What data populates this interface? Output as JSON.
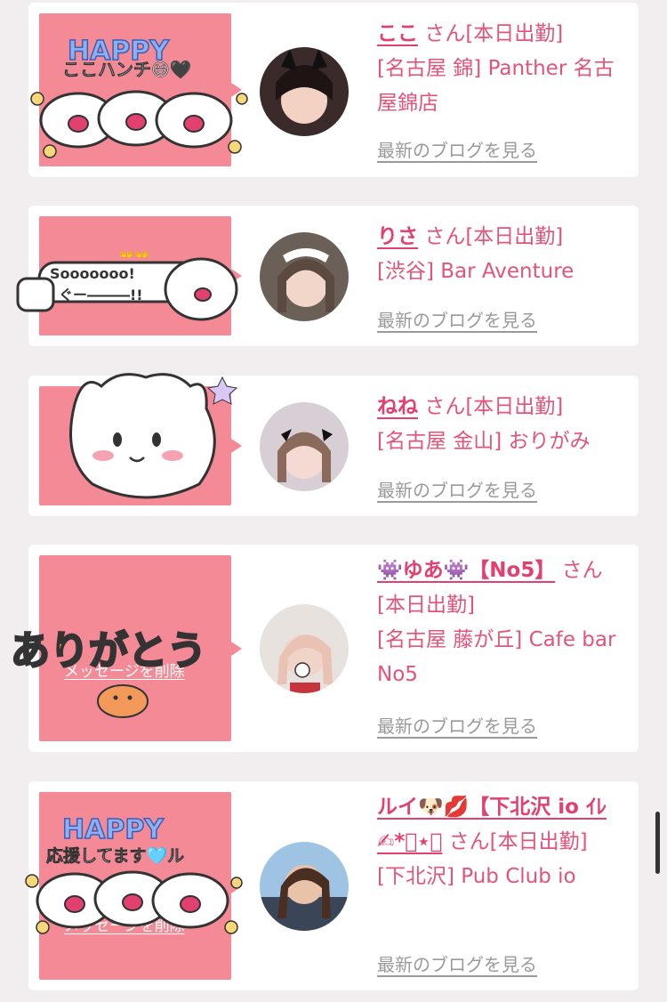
{
  "colors": {
    "accent": "#e2406f",
    "sticker_bg": "#f58a97",
    "link_gray": "#9a9a9a",
    "page_bg": "#f2eeef"
  },
  "cards": [
    {
      "name": "ここ",
      "san_label": "さん",
      "status": "[本日出勤]",
      "shop": "[名古屋 錦] Panther 名古屋錦店",
      "blog_link": "最新のブログを見る",
      "sticker": {
        "happy": "HAPPY",
        "caption": "ここハンチ😆🖤"
      }
    },
    {
      "name": "りさ",
      "san_label": "さん",
      "status": "[本日出勤]",
      "shop": "[渋谷] Bar Aventure",
      "blog_link": "最新のブログを見る",
      "sticker": {
        "line1": "Sooooooo!",
        "line2": "ぐー―――!!"
      }
    },
    {
      "name": "ねね",
      "san_label": "さん",
      "status": "[本日出勤]",
      "shop": "[名古屋 金山] おりがみ",
      "blog_link": "最新のブログを見る",
      "sticker": {}
    },
    {
      "name": "👾ゆあ👾【No5】",
      "san_label": "さん",
      "status": "[本日出勤]",
      "shop": "[名古屋 藤が丘] Cafe bar No5",
      "blog_link": "最新のブログを見る",
      "sticker": {
        "arigatou": "ありがとう",
        "delete": "メッセージを削除"
      }
    },
    {
      "name": "ルイ🐶💋【下北沢 io ｲﾚ✍︎*ﾟ⋆】",
      "san_label": "さん",
      "status": "[本日出勤]",
      "shop": "[下北沢] Pub Club io",
      "blog_link": "最新のブログを見る",
      "sticker": {
        "happy": "HAPPY",
        "caption": "応援してます🩵ル",
        "delete": "メッセージを削除"
      }
    }
  ]
}
